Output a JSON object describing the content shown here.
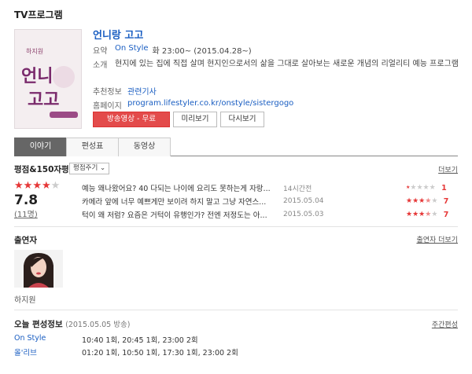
{
  "header": {
    "title": "TV프로그램"
  },
  "program": {
    "title": "언니랑 고고",
    "poster_text": "언니랑 고고",
    "poster_sub": "하지원",
    "summary_label": "요약",
    "channel": "On Style",
    "airtime": "화 23:00~ (2015.04.28~)",
    "intro_label": "소개",
    "description": "현지에 있는 집에 직접 살며 현지인으로서의 삶을 그대로 살아보는 새로운 개념의 리얼리티 예능 프로그램",
    "recommend_label": "추천정보",
    "recommend_link": "관련기사",
    "homepage_label": "홈페이지",
    "homepage_url": "program.lifestyler.co.kr/onstyle/sistergogo"
  },
  "buttons": {
    "broadcast": "방송영상 - 무료",
    "preview": "미리보기",
    "replay": "다시보기"
  },
  "tabs": [
    {
      "label": "이야기"
    },
    {
      "label": "편성표"
    },
    {
      "label": "동영상"
    }
  ],
  "ratings": {
    "title": "평점&150자평",
    "sort_label": "평점주기 ⌄",
    "more": "더보기",
    "average_stars": 4,
    "score": "7.8",
    "count": "(11명)",
    "reviews": [
      {
        "text": "예능 왜나왔어요? 40 다되는 나이에 요리도 못하는게 자랑...",
        "date": "14시간전",
        "stars": 1,
        "score": "1"
      },
      {
        "text": "카메라 앞에 너무 예쁘게만 보이려 하지 말고 그냥 자연스...",
        "date": "2015.05.04",
        "stars": 3.5,
        "score": "7"
      },
      {
        "text": "턱이 왜 저럼? 요즘은 거턱이 유행인가? 전엔 저정도는 아...",
        "date": "2015.05.03",
        "stars": 3.5,
        "score": "7"
      }
    ]
  },
  "cast": {
    "title": "출연자",
    "more": "출연자 더보기",
    "members": [
      {
        "name": "하지원"
      }
    ]
  },
  "schedule": {
    "title": "오늘 편성정보",
    "date_note": "(2015.05.05 방송)",
    "weekly_link": "주간편성",
    "rows": [
      {
        "channel": "On Style",
        "times": "10:40 1회, 20:45 1회, 23:00 2회"
      },
      {
        "channel": "올'리브",
        "times": "01:20 1회, 10:50 1회, 17:30 1회, 23:00 2회"
      }
    ]
  },
  "colors": {
    "accent": "#1a5ec2",
    "star": "#e63737",
    "primary_button": "#e34b4b"
  }
}
